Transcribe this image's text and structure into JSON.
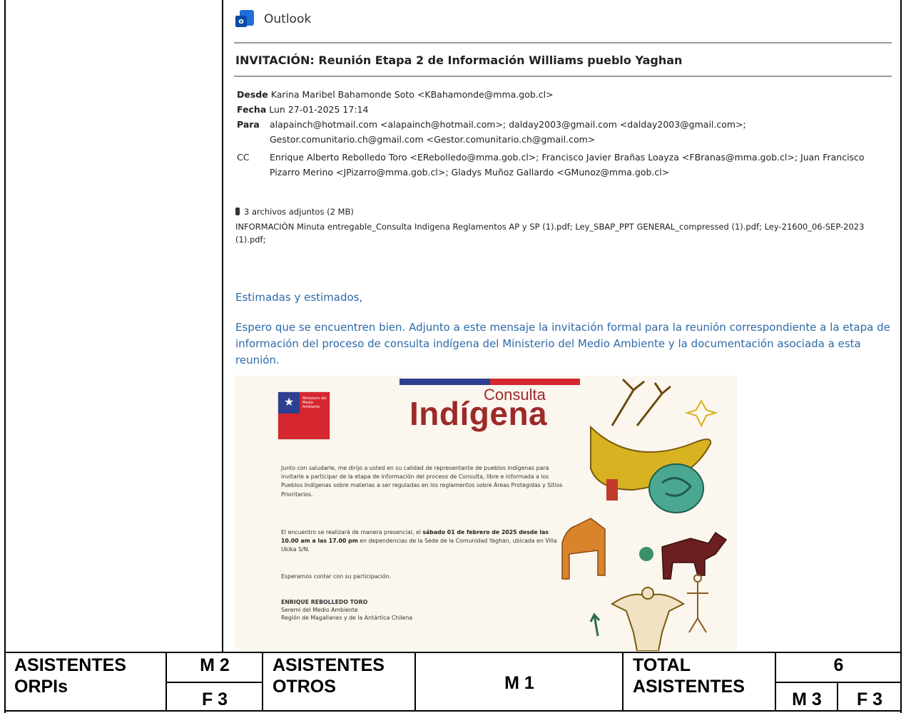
{
  "outlook": {
    "app_name": "Outlook",
    "subject": "INVITACIÓN: Reunión Etapa 2 de Información Williams pueblo Yaghan",
    "from_label": "Desde",
    "from_value": "Karina Maribel Bahamonde Soto <KBahamonde@mma.gob.cl>",
    "date_label": "Fecha",
    "date_value": "Lun 27-01-2025 17:14",
    "to_label": "Para",
    "to_value": "alapainch@hotmail.com <alapainch@hotmail.com>; dalday2003@gmail.com <dalday2003@gmail.com>; Gestor.comunitario.ch@gmail.com <Gestor.comunitario.ch@gmail.com>",
    "cc_label": "CC",
    "cc_value": "Enrique Alberto Rebolledo Toro <ERebolledo@mma.gob.cl>; Francisco Javier Brañas Loayza <FBranas@mma.gob.cl>; Juan Francisco Pizarro Merino <JPizarro@mma.gob.cl>; Gladys Muñoz Gallardo <GMunoz@mma.gob.cl>",
    "attachments_summary": "3 archivos adjuntos (2 MB)",
    "attachments_list": "INFORMACIÓN Minuta entregable_Consulta Indigena Reglamentos AP y SP (1).pdf; Ley_SBAP_PPT GENERAL_compressed (1).pdf; Ley-21600_06-SEP-2023 (1).pdf;",
    "greeting": "Estimadas y estimados,",
    "body": "Espero que se encuentren bien. Adjunto a este mensaje la invitación formal para la reunión correspondiente a la etapa de información del proceso de consulta indígena del Ministerio del Medio Ambiente y la documentación asociada a esta reunión."
  },
  "poster": {
    "logo_text": "Ministerio del Medio Ambiente",
    "consulta": "Consulta",
    "indigena": "Indígena",
    "paragraph1": "Junto con saludarle, me dirijo a usted en su calidad de representante de pueblos indígenas para invitarle a participar de la etapa de información del proceso de Consulta, libre e informada a los Pueblos Indígenas sobre materias a ser reguladas en los reglamentos sobre Áreas Protegidas y Sitios Prioritarios.",
    "paragraph2_a": "El encuentro se realizará de manera presencial, el ",
    "paragraph2_bold": "sábado 01 de febrero de 2025 desde las 10.00 am a las 17.00 pm",
    "paragraph2_b": " en dependencias de la Sede de la Comunidad Yaghan, ubicada en Villa Ukika S/N.",
    "paragraph3": "Esperamos contar con su participación.",
    "signer_name": "ENRIQUE REBOLLEDO TORO",
    "signer_title": "Seremi del Medio Ambiente",
    "signer_region": "Región de Magallanes y de la Antártica Chilena"
  },
  "attendance": {
    "orpi_label_1": "ASISTENTES",
    "orpi_label_2": "ORPIs",
    "orpi_m": "M 2",
    "orpi_f": "F 3",
    "otros_label_1": "ASISTENTES",
    "otros_label_2": "OTROS",
    "otros_m": "M 1",
    "total_label_1": "TOTAL",
    "total_label_2": "ASISTENTES",
    "total_value": "6",
    "total_m": "M 3",
    "total_f": "F 3"
  },
  "colors": {
    "link_blue": "#2e6aa8",
    "poster_red": "#9c2a2a",
    "flag_blue": "#2d3f8f",
    "flag_red": "#d6262f"
  }
}
